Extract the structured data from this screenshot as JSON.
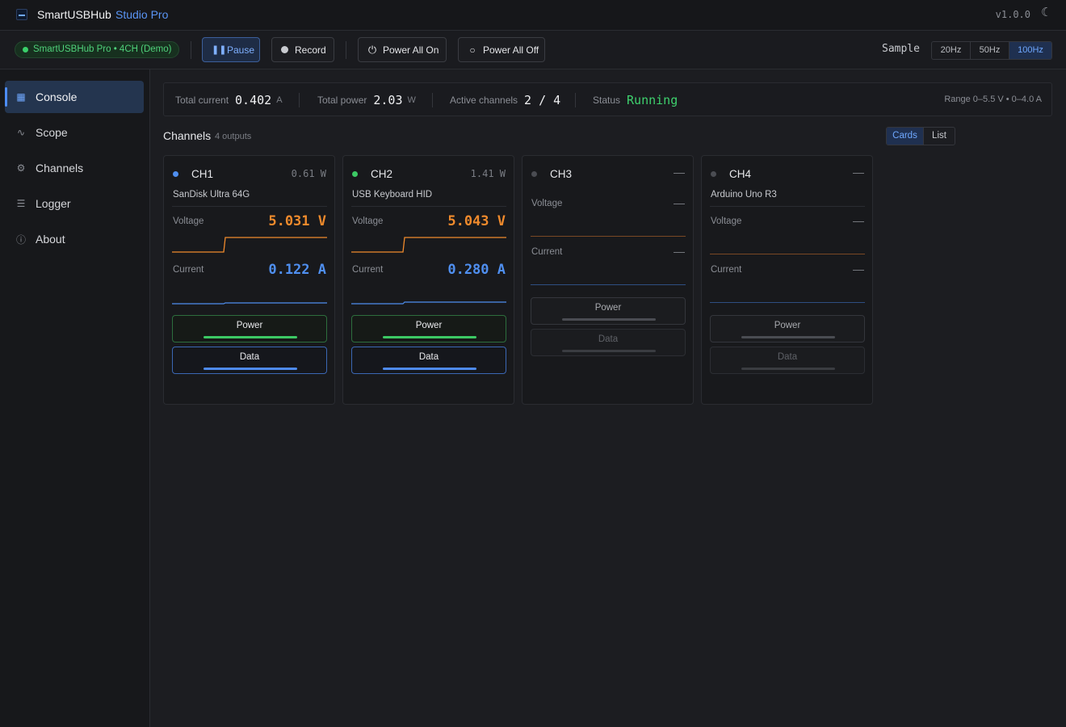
{
  "app": {
    "name": "SmartUSBHub",
    "edition": "Studio Pro",
    "version": "v1.0.0",
    "theme_icon": "moon-icon"
  },
  "toolbar": {
    "device": "SmartUSBHub Pro  •  4CH (Demo)",
    "pause_label": "Pause",
    "record_label": "Record",
    "power_all_on_label": "Power All On",
    "power_all_off_label": "Power All Off",
    "sample_label": "Sample",
    "sample_rates": [
      "20Hz",
      "50Hz",
      "100Hz"
    ],
    "sample_rate_selected": "100Hz"
  },
  "sidebar": {
    "items": [
      {
        "label": "Console",
        "icon": "grid-icon",
        "active": true
      },
      {
        "label": "Scope",
        "icon": "wave-icon",
        "active": false
      },
      {
        "label": "Channels",
        "icon": "gear-icon",
        "active": false
      },
      {
        "label": "Logger",
        "icon": "list-icon",
        "active": false
      },
      {
        "label": "About",
        "icon": "info-icon",
        "active": false
      }
    ]
  },
  "stats": {
    "total_current_label": "Total current",
    "total_current": "0.402",
    "total_current_unit": "A",
    "total_power_label": "Total power",
    "total_power": "2.03",
    "total_power_unit": "W",
    "active_channels_label": "Active channels",
    "active_channels": "2 / 4",
    "status_label": "Status",
    "status": "Running",
    "range": "Range 0–5.5 V  •  0–4.0 A"
  },
  "channels": {
    "title": "Channels",
    "subtitle": "4 outputs",
    "view_options": [
      "Cards",
      "List"
    ],
    "view_selected": "Cards",
    "voltage_label": "Voltage",
    "current_label": "Current",
    "power_button_label": "Power",
    "data_button_label": "Data",
    "dash": "—",
    "items": [
      {
        "name": "CH1",
        "device": "SanDisk Ultra 64G",
        "power": "0.61 W",
        "voltage": "5.031 V",
        "current": "0.122 A",
        "dot_color": "#4f8ff0",
        "active": true
      },
      {
        "name": "CH2",
        "device": "USB Keyboard HID",
        "power": "1.41 W",
        "voltage": "5.043 V",
        "current": "0.280 A",
        "dot_color": "#3cc964",
        "active": true
      },
      {
        "name": "CH3",
        "device": "",
        "power": "—",
        "voltage": "—",
        "current": "—",
        "dot_color": "#4a4c52",
        "active": false
      },
      {
        "name": "CH4",
        "device": "Arduino Uno R3",
        "power": "—",
        "voltage": "—",
        "current": "—",
        "dot_color": "#4a4c52",
        "active": false
      }
    ]
  },
  "colors": {
    "accent": "#4f8ff0",
    "voltage": "#f08a2c",
    "ok": "#3cc964"
  }
}
